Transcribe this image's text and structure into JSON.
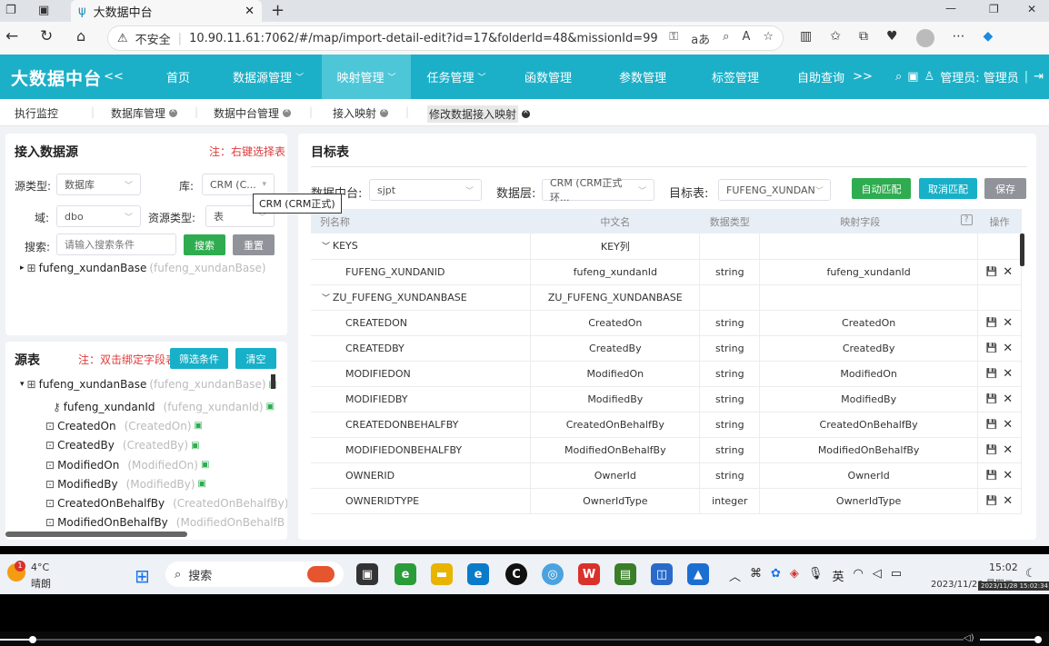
{
  "browser": {
    "tab_title": "大数据中台",
    "insecure_label": "不安全",
    "url": "10.90.11.61:7062/#/map/import-detail-edit?id=17&folderId=48&missionId=99"
  },
  "app": {
    "logo": "大数据中台",
    "collapse": "<<",
    "nav": [
      "首页",
      "数据源管理",
      "映射管理",
      "任务管理",
      "函数管理",
      "参数管理",
      "标签管理",
      "自助查询"
    ],
    "more": ">>",
    "user": "管理员: 管理员"
  },
  "tabs": [
    "执行监控",
    "数据库管理",
    "数据中台管理",
    "接入映射",
    "修改数据接入映射"
  ],
  "left_top": {
    "title": "接入数据源",
    "hint": "注：右键选择表",
    "source_type_label": "源类型:",
    "source_type_value": "数据库",
    "db_label": "库:",
    "db_value": "CRM (C...",
    "tooltip": "CRM (CRM正式)",
    "domain_label": "域:",
    "domain_value": "dbo",
    "res_type_label": "资源类型:",
    "res_type_value": "表",
    "search_label": "搜索:",
    "search_placeholder": "请输入搜索条件",
    "search_btn": "搜索",
    "reset_btn": "重置",
    "tree_node": "fufeng_xundanBase",
    "tree_node_alias": "(fufeng_xundanBase)"
  },
  "left_bottom": {
    "title": "源表",
    "hint": "注：双击绑定字段表",
    "filter_btn": "筛选条件",
    "clear_btn": "清空",
    "root": {
      "name": "fufeng_xundanBase",
      "alias": "(fufeng_xundanBase)"
    },
    "fields": [
      {
        "name": "fufeng_xundanId",
        "alias": "(fufeng_xundanId)",
        "key": true
      },
      {
        "name": "CreatedOn",
        "alias": "(CreatedOn)"
      },
      {
        "name": "CreatedBy",
        "alias": "(CreatedBy)"
      },
      {
        "name": "ModifiedOn",
        "alias": "(ModifiedOn)"
      },
      {
        "name": "ModifiedBy",
        "alias": "(ModifiedBy)"
      },
      {
        "name": "CreatedOnBehalfBy",
        "alias": "(CreatedOnBehalfBy)"
      },
      {
        "name": "ModifiedOnBehalfBy",
        "alias": "(ModifiedOnBehalfB"
      }
    ]
  },
  "right": {
    "title": "目标表",
    "platform_label": "数据中台:",
    "platform_value": "sjpt",
    "layer_label": "数据层:",
    "layer_value": "CRM (CRM正式环...",
    "target_label": "目标表:",
    "target_value": "FUFENG_XUNDAN",
    "auto_btn": "自动匹配",
    "cancel_btn": "取消匹配",
    "save_btn": "保存",
    "columns": [
      "列名称",
      "中文名",
      "数据类型",
      "映射字段",
      "?",
      "操作"
    ],
    "rows": [
      {
        "type": "group",
        "name": "KEYS",
        "cn": "KEY列"
      },
      {
        "type": "row",
        "name": "FUFENG_XUNDANID",
        "cn": "fufeng_xundanId",
        "dtype": "string",
        "map": "fufeng_xundanId"
      },
      {
        "type": "group",
        "name": "ZU_FUFENG_XUNDANBASE",
        "cn": "ZU_FUFENG_XUNDANBASE"
      },
      {
        "type": "row",
        "name": "CREATEDON",
        "cn": "CreatedOn",
        "dtype": "string",
        "map": "CreatedOn"
      },
      {
        "type": "row",
        "name": "CREATEDBY",
        "cn": "CreatedBy",
        "dtype": "string",
        "map": "CreatedBy"
      },
      {
        "type": "row",
        "name": "MODIFIEDON",
        "cn": "ModifiedOn",
        "dtype": "string",
        "map": "ModifiedOn"
      },
      {
        "type": "row",
        "name": "MODIFIEDBY",
        "cn": "ModifiedBy",
        "dtype": "string",
        "map": "ModifiedBy"
      },
      {
        "type": "row",
        "name": "CREATEDONBEHALFBY",
        "cn": "CreatedOnBehalfBy",
        "dtype": "string",
        "map": "CreatedOnBehalfBy"
      },
      {
        "type": "row",
        "name": "MODIFIEDONBEHALFBY",
        "cn": "ModifiedOnBehalfBy",
        "dtype": "string",
        "map": "ModifiedOnBehalfBy"
      },
      {
        "type": "row",
        "name": "OWNERID",
        "cn": "OwnerId",
        "dtype": "string",
        "map": "OwnerId"
      },
      {
        "type": "row",
        "name": "OWNERIDTYPE",
        "cn": "OwnerIdType",
        "dtype": "integer",
        "map": "OwnerIdType"
      }
    ]
  },
  "taskbar": {
    "weather_temp": "4°C",
    "weather_desc": "晴朗",
    "notif_count": "1",
    "search": "搜索",
    "ime": "英",
    "time": "15:02",
    "date": "2023/11/28 星期二",
    "stamp": "2023/11/28 15:02:34"
  }
}
